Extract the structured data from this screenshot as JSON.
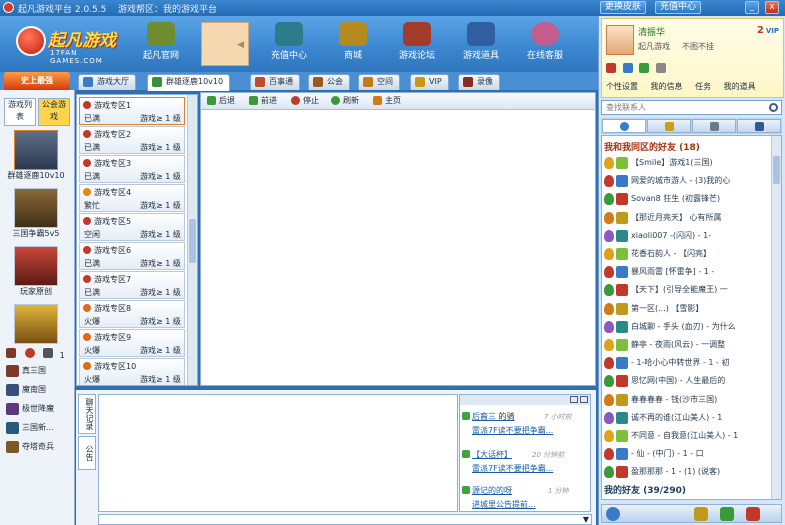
{
  "titlebar": {
    "app_title": "起凡游戏平台 2.0.5.5",
    "subtitle": "游戏帮区：我的游戏平台",
    "btn_change_skin": "更换皮肤",
    "btn_recharge": "充值中心",
    "win_min": "_",
    "win_close": "x"
  },
  "logo": {
    "text": "起凡游戏",
    "sub": "17FAN GAMES.COM"
  },
  "nav": [
    {
      "label": "起凡官网",
      "color": "#6f8c2f"
    },
    {
      "label": "充值中心",
      "color": "#2d7a8c"
    },
    {
      "label": "商城",
      "color": "#b58a1e"
    },
    {
      "label": "游戏论坛",
      "color": "#a33a2a"
    },
    {
      "label": "游戏道具",
      "color": "#315e9e"
    },
    {
      "label": "在线客服",
      "color": "#c45c8d"
    }
  ],
  "promo": "史上最强",
  "tabs": [
    {
      "label": "游戏大厅",
      "color": "#3a7bc8"
    },
    {
      "label": "群雄逐鹿10v10",
      "color": "#3a8f3a"
    },
    {
      "label": "百事通",
      "color": "#c04a2a"
    },
    {
      "label": "公会",
      "color": "#9a5a20"
    },
    {
      "label": "空间",
      "color": "#c47a10"
    },
    {
      "label": "VIP",
      "color": "#c89a10"
    },
    {
      "label": "录像",
      "color": "#8a2a20"
    }
  ],
  "left": {
    "tab1": "游戏列表",
    "tab2": "公会游戏",
    "games": [
      {
        "label": "群雄逐鹿10v10",
        "color1": "#5f6f86",
        "color2": "#2c3a50"
      },
      {
        "label": "三国争霸5v5",
        "color1": "#8a6a36",
        "color2": "#3f2f18"
      },
      {
        "label": "玩家原创",
        "color1": "#c8473a",
        "color2": "#5c1a14"
      },
      {
        "label": "",
        "color1": "#e0b43c",
        "color2": "#7a4f10"
      }
    ],
    "count": "1",
    "small": [
      {
        "label": "真三国",
        "color": "#7b3a2a"
      },
      {
        "label": "魔南国",
        "color": "#3a4f7b"
      },
      {
        "label": "极世降魔",
        "color": "#5a3a7b"
      },
      {
        "label": "三国新...",
        "color": "#2a5a7b"
      },
      {
        "label": "夺塔奇兵",
        "color": "#7b5a2a"
      }
    ]
  },
  "rooms": [
    {
      "name": "游戏专区1",
      "status": "已满",
      "level": "游戏≥ 1 级",
      "dot": "#c0392b"
    },
    {
      "name": "游戏专区2",
      "status": "已满",
      "level": "游戏≥ 1 级",
      "dot": "#c0392b"
    },
    {
      "name": "游戏专区3",
      "status": "已满",
      "level": "游戏≥ 1 级",
      "dot": "#c0392b"
    },
    {
      "name": "游戏专区4",
      "status": "繁忙",
      "level": "游戏≥ 1 级",
      "dot": "#e08a1a"
    },
    {
      "name": "游戏专区5",
      "status": "空闲",
      "level": "游戏≥ 1 级",
      "dot": "#c0392b"
    },
    {
      "name": "游戏专区6",
      "status": "已满",
      "level": "游戏≥ 1 级",
      "dot": "#c0392b"
    },
    {
      "name": "游戏专区7",
      "status": "已满",
      "level": "游戏≥ 1 级",
      "dot": "#c0392b"
    },
    {
      "name": "游戏专区8",
      "status": "火爆",
      "level": "游戏≥ 1 级",
      "dot": "#e06a1a"
    },
    {
      "name": "游戏专区9",
      "status": "火爆",
      "level": "游戏≥ 1 级",
      "dot": "#e06a1a"
    },
    {
      "name": "游戏专区10",
      "status": "火爆",
      "level": "游戏≥ 1 级",
      "dot": "#e06a1a"
    }
  ],
  "browser": {
    "back": "后退",
    "forward": "前进",
    "stop": "停止",
    "refresh": "刷新",
    "home": "主页"
  },
  "chat": {
    "tab1": "聊天记录",
    "tab2": "公告",
    "news": [
      {
        "title": "后裔三",
        "suffix": "的骑",
        "time": "7 小时前",
        "body": "雷派7F读不要把争霸..."
      },
      {
        "title": "【大话杯】",
        "time": "20 分钟前",
        "body": "雷派7F读不要把争霸..."
      },
      {
        "title": "源记的的呀",
        "time": "1 分钟",
        "body": "进城里公告提前..."
      }
    ]
  },
  "profile": {
    "name": "清振华",
    "status1": "起凡游戏",
    "status2": "不图不挂",
    "beans": "2",
    "beans_suffix": "VIP",
    "actions": [
      "个性设置",
      "我的信息",
      "任务",
      "我的道具"
    ]
  },
  "search_placeholder": "查找联系人",
  "friends": {
    "group1": "我和我同区的好友 (18)",
    "group2": "我的好友 (39/290)",
    "list": [
      "【Smile】游戏1(三国)",
      "网爱的城市游人 - (3)我的心",
      "Sovan8 狂生 (初露锋芒)",
      "【那近月亮天】 心有所属",
      "xiaoli007 -(闪闪) - 1-",
      "花香石韵人 - 【闪亮】",
      "暴风雨雷 [怀雷争] - 1 -",
      "【天下】(引导全能魔王) 一",
      "第一区(...) 【雪影】",
      "白城聊 - 手头 (血刃) - 为什么",
      "静亭 - 夜雨(风云) - 一调整",
      "- 1-哈小心中转世界 - 1 - 初",
      "思忆网(中国) - 人生最后的",
      "春春春春 - 钱(沙市三国)",
      "诚不再的谁(江山美人) - 1",
      "不同意 - 自我意(江山美人) - 1",
      "- 仙 - (中门) - 1 - 口",
      "盈那那那 - 1 - (1) (说客)"
    ]
  }
}
